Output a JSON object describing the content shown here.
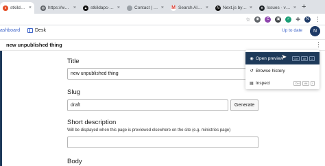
{
  "browser": {
    "tabs": [
      {
        "title": "stkilda - Sani",
        "active": true,
        "favicon_color": "#e44d26",
        "favicon_icon": "sanity-icon"
      },
      {
        "title": "https://www.c",
        "active": false,
        "favicon_color": "#5f6368",
        "favicon_icon": "globe-icon"
      },
      {
        "title": "stkildapc-nev",
        "active": false,
        "favicon_color": "#111111",
        "favicon_icon": "vercel-icon"
      },
      {
        "title": "Contact | St K",
        "active": false,
        "favicon_color": "#9aa0a6",
        "favicon_icon": "page-icon"
      },
      {
        "title": "Search Alert fo",
        "active": false,
        "favicon_color": "#d93025",
        "favicon_icon": "gmail-icon"
      },
      {
        "title": "Next.js by Ver",
        "active": false,
        "favicon_color": "#111111",
        "favicon_icon": "nextjs-icon"
      },
      {
        "title": "Issues · vercel",
        "active": false,
        "favicon_color": "#24292e",
        "favicon_icon": "github-icon"
      }
    ],
    "new_tab": "+",
    "extensions": [
      "extension-icon-1",
      "extension-icon-c",
      "extension-icon-3",
      "extension-icon-4",
      "puzzle-icon",
      "profile-icon"
    ]
  },
  "app": {
    "nav_dashboard": "ashboard",
    "nav_desk": "Desk",
    "status": "Up to date",
    "avatar_initial": "N",
    "document_title": "new unpublished thing",
    "menu_icon": "more-vertical-icon",
    "accent_color": "#3d63c8",
    "dark_color": "#1e3a5a"
  },
  "form": {
    "title_label": "Title",
    "title_value": "new unpublished thing",
    "slug_label": "Slug",
    "slug_value": "draft",
    "generate_label": "Generate",
    "short_desc_label": "Short description",
    "short_desc_hint": "Will be displayed when this page is previewed elsewhere on the site (e.g. ministries page)",
    "short_desc_value": "",
    "body_label": "Body"
  },
  "menu": {
    "items": [
      {
        "label": "Open preview",
        "icon": "eye-icon",
        "shortcut": [
          "Ctrl",
          "Alt",
          "O"
        ],
        "highlighted": true
      },
      {
        "label": "Browse history",
        "icon": "history-icon",
        "shortcut": [],
        "highlighted": false
      },
      {
        "label": "Inspect",
        "icon": "inspect-icon",
        "shortcut": [
          "Ctrl",
          "Alt",
          "I"
        ],
        "highlighted": false
      }
    ]
  }
}
